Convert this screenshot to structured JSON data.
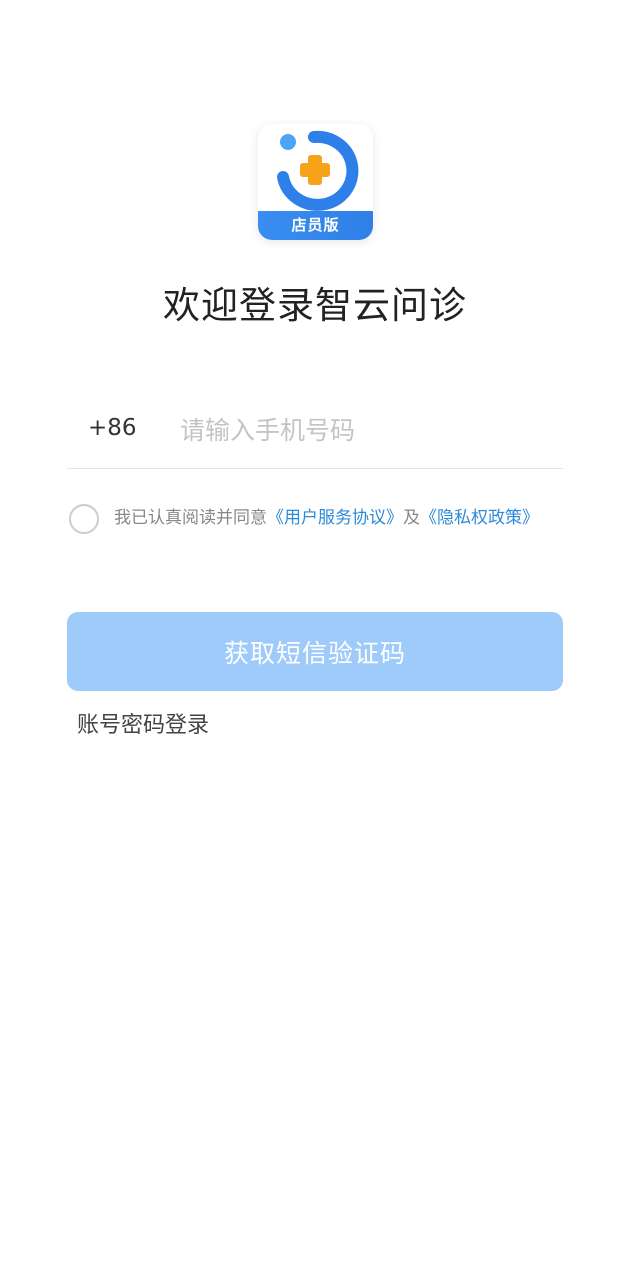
{
  "logo": {
    "badge_label": "店员版",
    "icon": "app-logo-icon",
    "colors": {
      "blue": "#2f7fe8",
      "light_blue": "#4da3f5",
      "orange": "#f7a31a"
    }
  },
  "welcome": {
    "title": "欢迎登录智云问诊"
  },
  "phone": {
    "country_code": "+86",
    "placeholder": "请输入手机号码",
    "value": ""
  },
  "agreement": {
    "checked": false,
    "prefix": "我已认真阅读并同意",
    "user_agreement": "《用户服务协议》",
    "conjunction": "及",
    "privacy_policy": "《隐私权政策》"
  },
  "actions": {
    "sms_button_label": "获取短信验证码",
    "password_login_label": "账号密码登录"
  },
  "colors": {
    "accent": "#2d8ad9",
    "button_disabled": "#9ecbfa",
    "title_text": "#222222",
    "muted_text": "#888888"
  }
}
